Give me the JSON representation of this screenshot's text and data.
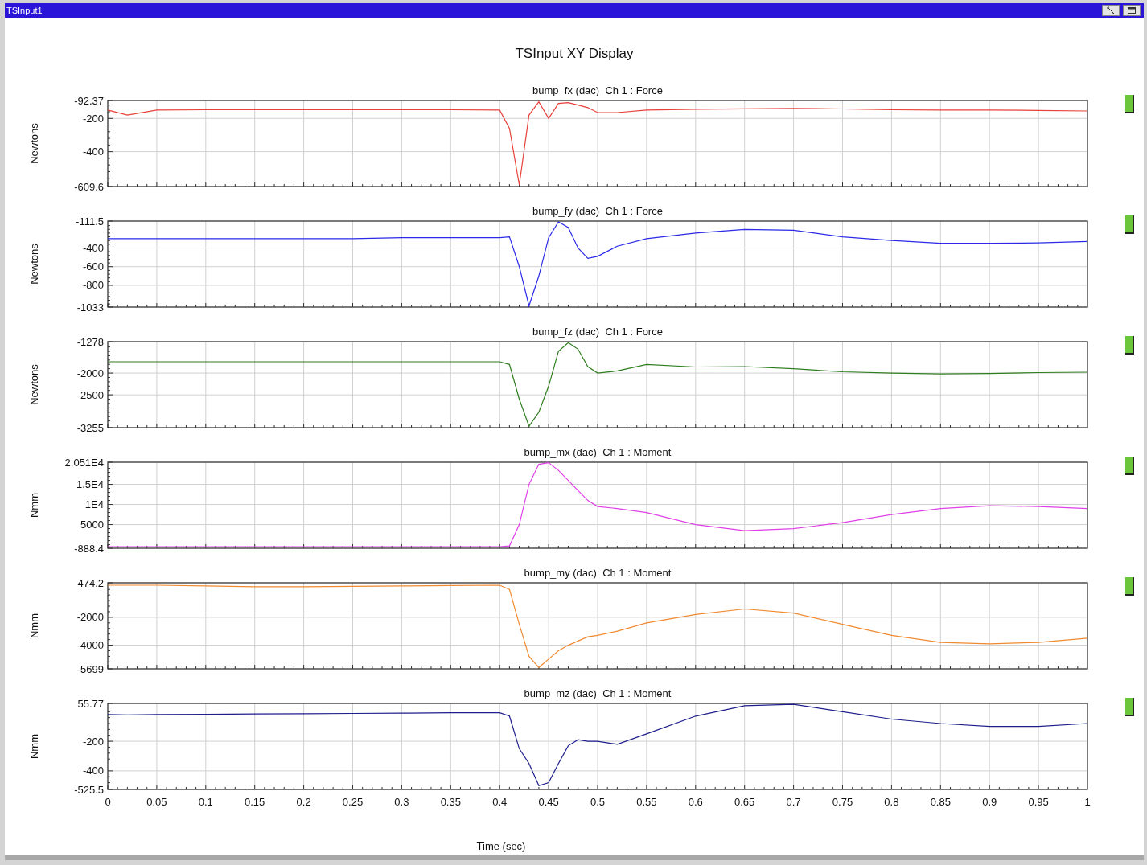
{
  "window": {
    "title": "TSInput1"
  },
  "display": {
    "title": "TSInput XY Display"
  },
  "charts": [
    {
      "chart_data": {
        "type": "line",
        "grid": true,
        "title": "bump_fx (dac)  Ch 1 : Force",
        "ylabel": "Newtons",
        "xlim": [
          0,
          1
        ],
        "ylim": [
          -609.6,
          -92.37
        ],
        "yticks": [
          {
            "value": -92.37,
            "label": "-92.37"
          },
          {
            "value": -200,
            "label": "-200"
          },
          {
            "value": -400,
            "label": "-400"
          },
          {
            "value": -609.6,
            "label": "-609.6"
          }
        ],
        "x": [
          0,
          0.02,
          0.05,
          0.1,
          0.15,
          0.2,
          0.25,
          0.3,
          0.35,
          0.4,
          0.41,
          0.42,
          0.43,
          0.44,
          0.45,
          0.46,
          0.47,
          0.48,
          0.49,
          0.5,
          0.52,
          0.55,
          0.6,
          0.65,
          0.7,
          0.75,
          0.8,
          0.85,
          0.9,
          0.95,
          1
        ],
        "series": [
          {
            "color": "#e8403a",
            "values": [
              -150,
              -180,
              -150,
              -148,
              -148,
              -148,
              -148,
              -148,
              -148,
              -150,
              -260,
              -600,
              -180,
              -100,
              -200,
              -110,
              -105,
              -120,
              -135,
              -165,
              -165,
              -150,
              -145,
              -142,
              -140,
              -143,
              -148,
              -150,
              -150,
              -152,
              -155
            ]
          }
        ]
      }
    },
    {
      "chart_data": {
        "type": "line",
        "grid": true,
        "title": "bump_fy (dac)  Ch 1 : Force",
        "ylabel": "Newtons",
        "xlim": [
          0,
          1
        ],
        "ylim": [
          -1033,
          -111.5
        ],
        "yticks": [
          {
            "value": -111.5,
            "label": "-111.5"
          },
          {
            "value": -400,
            "label": "-400"
          },
          {
            "value": -600,
            "label": "-600"
          },
          {
            "value": -800,
            "label": "-800"
          },
          {
            "value": -1033,
            "label": "-1033"
          }
        ],
        "x": [
          0,
          0.02,
          0.05,
          0.1,
          0.15,
          0.2,
          0.25,
          0.3,
          0.35,
          0.4,
          0.41,
          0.42,
          0.43,
          0.44,
          0.45,
          0.46,
          0.47,
          0.48,
          0.49,
          0.5,
          0.52,
          0.55,
          0.6,
          0.65,
          0.7,
          0.75,
          0.8,
          0.85,
          0.9,
          0.95,
          1
        ],
        "series": [
          {
            "color": "#2a2ae8",
            "values": [
              -300,
              -300,
              -300,
              -300,
              -300,
              -300,
              -300,
              -290,
              -290,
              -290,
              -280,
              -600,
              -1020,
              -700,
              -290,
              -120,
              -180,
              -400,
              -510,
              -490,
              -380,
              -300,
              -240,
              -200,
              -210,
              -280,
              -320,
              -350,
              -350,
              -345,
              -330
            ]
          }
        ]
      }
    },
    {
      "chart_data": {
        "type": "line",
        "grid": true,
        "title": "bump_fz (dac)  Ch 1 : Force",
        "ylabel": "Newtons",
        "xlim": [
          0,
          1
        ],
        "ylim": [
          -3255,
          -1278
        ],
        "yticks": [
          {
            "value": -1278,
            "label": "-1278"
          },
          {
            "value": -2000,
            "label": "-2000"
          },
          {
            "value": -2500,
            "label": "-2500"
          },
          {
            "value": -3255,
            "label": "-3255"
          }
        ],
        "x": [
          0,
          0.02,
          0.05,
          0.1,
          0.15,
          0.2,
          0.25,
          0.3,
          0.35,
          0.4,
          0.41,
          0.42,
          0.43,
          0.44,
          0.45,
          0.46,
          0.47,
          0.48,
          0.49,
          0.5,
          0.52,
          0.55,
          0.6,
          0.65,
          0.7,
          0.75,
          0.8,
          0.85,
          0.9,
          0.95,
          1
        ],
        "series": [
          {
            "color": "#2e7d1e",
            "values": [
              -1740,
              -1740,
              -1740,
              -1740,
              -1740,
              -1740,
              -1740,
              -1740,
              -1740,
              -1740,
              -1800,
              -2600,
              -3220,
              -2900,
              -2300,
              -1500,
              -1300,
              -1450,
              -1850,
              -2000,
              -1950,
              -1800,
              -1860,
              -1850,
              -1900,
              -1970,
              -2000,
              -2020,
              -2010,
              -1990,
              -1980
            ]
          }
        ]
      }
    },
    {
      "chart_data": {
        "type": "line",
        "grid": true,
        "title": "bump_mx (dac)  Ch 1 : Moment",
        "ylabel": "Nmm",
        "xlim": [
          0,
          1
        ],
        "ylim": [
          -888.4,
          20510
        ],
        "yticks": [
          {
            "value": 20510,
            "label": "2.051E4"
          },
          {
            "value": 15000,
            "label": "1.5E4"
          },
          {
            "value": 10000,
            "label": "1E4"
          },
          {
            "value": 5000,
            "label": "5000"
          },
          {
            "value": -888.4,
            "label": "-888.4"
          }
        ],
        "x": [
          0,
          0.02,
          0.05,
          0.1,
          0.15,
          0.2,
          0.25,
          0.3,
          0.35,
          0.4,
          0.41,
          0.42,
          0.43,
          0.44,
          0.45,
          0.46,
          0.47,
          0.48,
          0.49,
          0.5,
          0.52,
          0.55,
          0.6,
          0.65,
          0.7,
          0.75,
          0.8,
          0.85,
          0.9,
          0.95,
          1
        ],
        "series": [
          {
            "color": "#e040e8",
            "values": [
              -500,
              -500,
              -500,
              -500,
              -500,
              -500,
              -500,
              -500,
              -500,
              -500,
              -300,
              5000,
              15000,
              20000,
              20400,
              18500,
              16000,
              13500,
              11000,
              9500,
              9000,
              8000,
              5000,
              3500,
              4000,
              5500,
              7500,
              9000,
              9700,
              9500,
              9000
            ]
          }
        ]
      }
    },
    {
      "chart_data": {
        "type": "line",
        "grid": true,
        "title": "bump_my (dac)  Ch 1 : Moment",
        "ylabel": "Nmm",
        "xlim": [
          0,
          1
        ],
        "ylim": [
          -5699,
          474.2
        ],
        "yticks": [
          {
            "value": 474.2,
            "label": "474.2"
          },
          {
            "value": -2000,
            "label": "-2000"
          },
          {
            "value": -4000,
            "label": "-4000"
          },
          {
            "value": -5699,
            "label": "-5699"
          }
        ],
        "x": [
          0,
          0.02,
          0.05,
          0.1,
          0.15,
          0.2,
          0.25,
          0.3,
          0.35,
          0.4,
          0.41,
          0.42,
          0.43,
          0.44,
          0.45,
          0.46,
          0.47,
          0.48,
          0.49,
          0.5,
          0.52,
          0.55,
          0.6,
          0.65,
          0.7,
          0.75,
          0.8,
          0.85,
          0.9,
          0.95,
          1
        ],
        "series": [
          {
            "color": "#f08a30",
            "values": [
              300,
              300,
              300,
              250,
              200,
              200,
              220,
              250,
              280,
              300,
              0,
              -2500,
              -4800,
              -5600,
              -5000,
              -4400,
              -4000,
              -3700,
              -3400,
              -3300,
              -3000,
              -2400,
              -1800,
              -1400,
              -1700,
              -2500,
              -3300,
              -3800,
              -3900,
              -3800,
              -3500
            ]
          }
        ]
      }
    },
    {
      "chart_data": {
        "type": "line",
        "grid": true,
        "title": "bump_mz (dac)  Ch 1 : Moment",
        "ylabel": "Nmm",
        "xlabel": "Time (sec)",
        "xlim": [
          0,
          1
        ],
        "ylim": [
          -525.5,
          55.77
        ],
        "yticks": [
          {
            "value": 55.77,
            "label": "55.77"
          },
          {
            "value": -200,
            "label": "-200"
          },
          {
            "value": -400,
            "label": "-400"
          },
          {
            "value": -525.5,
            "label": "-525.5"
          }
        ],
        "xticks": [
          {
            "value": 0,
            "label": "0"
          },
          {
            "value": 0.05,
            "label": "0.05"
          },
          {
            "value": 0.1,
            "label": "0.1"
          },
          {
            "value": 0.15,
            "label": "0.15"
          },
          {
            "value": 0.2,
            "label": "0.2"
          },
          {
            "value": 0.25,
            "label": "0.25"
          },
          {
            "value": 0.3,
            "label": "0.3"
          },
          {
            "value": 0.35,
            "label": "0.35"
          },
          {
            "value": 0.4,
            "label": "0.4"
          },
          {
            "value": 0.45,
            "label": "0.45"
          },
          {
            "value": 0.5,
            "label": "0.5"
          },
          {
            "value": 0.55,
            "label": "0.55"
          },
          {
            "value": 0.6,
            "label": "0.6"
          },
          {
            "value": 0.65,
            "label": "0.65"
          },
          {
            "value": 0.7,
            "label": "0.7"
          },
          {
            "value": 0.75,
            "label": "0.75"
          },
          {
            "value": 0.8,
            "label": "0.8"
          },
          {
            "value": 0.85,
            "label": "0.85"
          },
          {
            "value": 0.9,
            "label": "0.9"
          },
          {
            "value": 0.95,
            "label": "0.95"
          },
          {
            "value": 1,
            "label": "1"
          }
        ],
        "x": [
          0,
          0.02,
          0.05,
          0.1,
          0.15,
          0.2,
          0.25,
          0.3,
          0.35,
          0.4,
          0.41,
          0.42,
          0.43,
          0.44,
          0.45,
          0.46,
          0.47,
          0.48,
          0.49,
          0.5,
          0.52,
          0.55,
          0.6,
          0.65,
          0.7,
          0.75,
          0.8,
          0.85,
          0.9,
          0.95,
          1
        ],
        "series": [
          {
            "color": "#1e1e8c",
            "values": [
              -20,
              -22,
              -20,
              -18,
              -16,
              -14,
              -12,
              -10,
              -8,
              -8,
              -30,
              -250,
              -350,
              -500,
              -480,
              -350,
              -230,
              -190,
              -200,
              -200,
              -220,
              -150,
              -30,
              40,
              50,
              0,
              -50,
              -80,
              -100,
              -100,
              -80
            ]
          }
        ]
      }
    }
  ]
}
